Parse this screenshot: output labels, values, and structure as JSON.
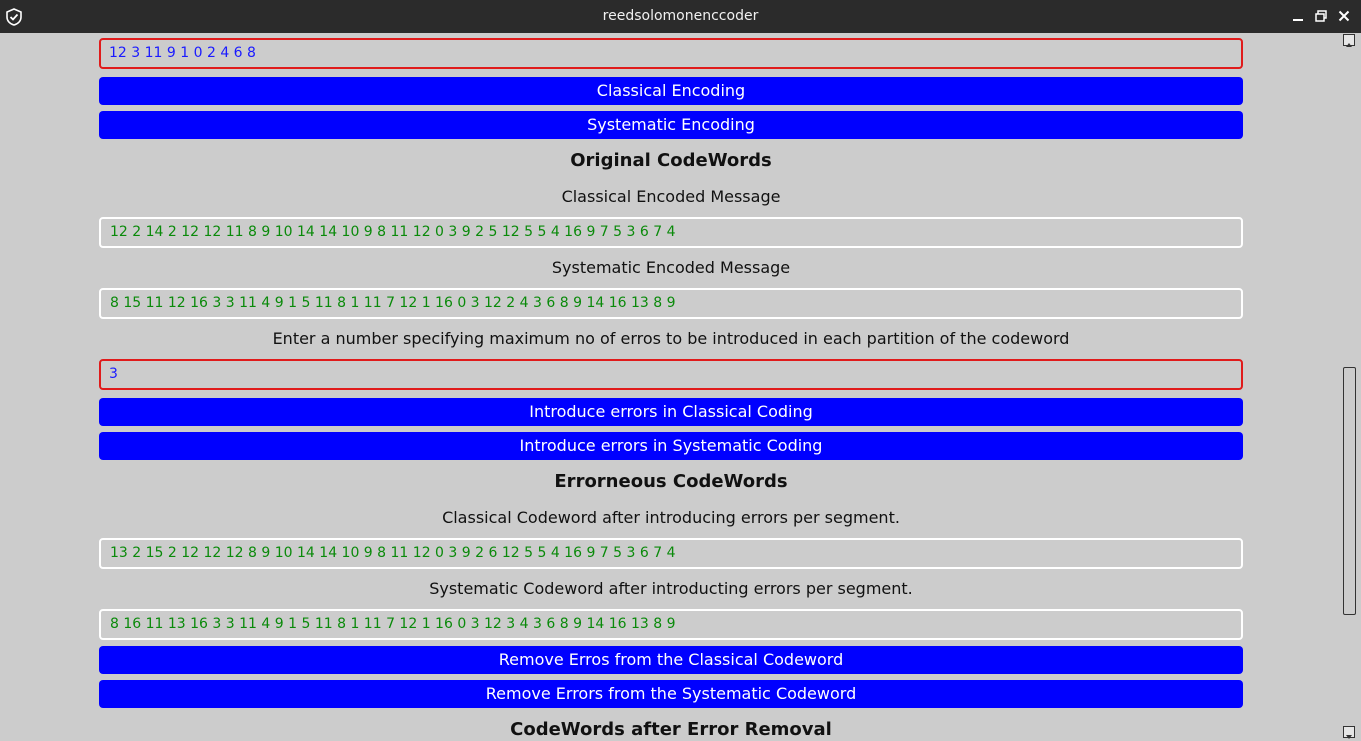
{
  "window": {
    "title": "reedsolomonenccoder"
  },
  "message_input": {
    "value": "12 3 11 9 1 0 2 4 6 8"
  },
  "buttons": {
    "classical_encoding": "Classical Encoding",
    "systematic_encoding": "Systematic Encoding",
    "introduce_classical": "Introduce errors in Classical Coding",
    "introduce_systematic": "Introduce errors in Systematic Coding",
    "remove_classical": "Remove Erros from the Classical Codeword",
    "remove_systematic": "Remove Errors from the Systematic Codeword"
  },
  "original": {
    "heading": "Original CodeWords",
    "classical_label": "Classical Encoded Message",
    "classical_value": "12 2 14 2 12 12 11 8 9 10 14 14 10 9 8 11 12 0 3 9 2 5 12 5 5 4 16 9 7 5 3 6 7 4",
    "systematic_label": "Systematic Encoded Message",
    "systematic_value": "8 15 11 12 16 3 3 11 4 9 1 5 11 8 1 11 7 12 1 16 0 3 12 2 4 3 6 8 9 14 16 13 8 9"
  },
  "errors_prompt": "Enter a number specifying maximum no of erros to be introduced in each partition of the codeword",
  "errors_input": {
    "value": "3"
  },
  "erroneous": {
    "heading": "Errorneous CodeWords",
    "classical_label": "Classical Codeword after introducing errors per segment.",
    "classical_value": "13 2 15 2 12 12 12 8 9 10 14 14 10 9 8 11 12 0 3 9 2 6 12 5 5 4 16 9 7 5 3 6 7 4",
    "systematic_label": "Systematic Codeword after introducting errors per segment.",
    "systematic_value": "8 16 11 13 16 3 3 11 4 9 1 5 11 8 1 11 7 12 1 16 0 3 12 3 4 3 6 8 9 14 16 13 8 9"
  },
  "after_removal": {
    "heading": "CodeWords after Error Removal"
  },
  "colors": {
    "button_bg": "#0000ff",
    "input_border": "#e01b1b",
    "input_text": "#1a1aff",
    "output_text": "#0a8a0a",
    "background": "#cccccc",
    "titlebar": "#2b2b2b"
  },
  "icons": {
    "app": "shield-check-icon",
    "minimize": "minimize-icon",
    "maximize": "restore-icon",
    "close": "close-icon"
  }
}
